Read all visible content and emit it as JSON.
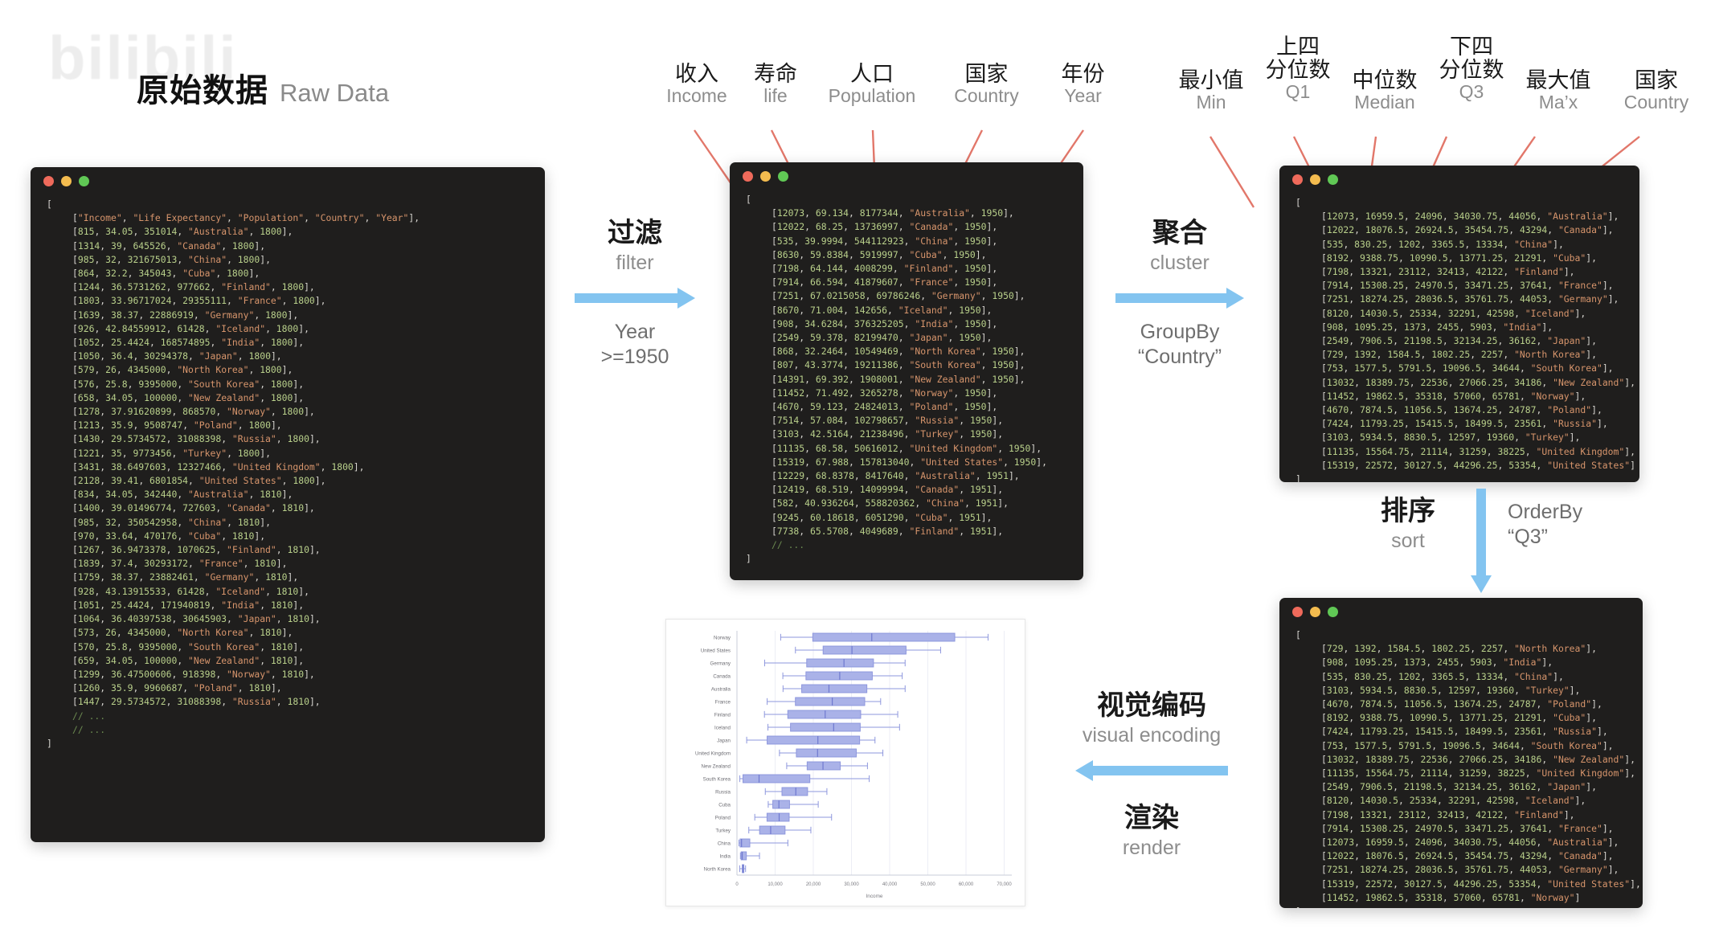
{
  "watermark": {
    "text": "bilibili"
  },
  "title": {
    "cn": "原始数据",
    "en": "Raw Data"
  },
  "raw_callouts": [
    {
      "cn": "收入",
      "en": "Income"
    },
    {
      "cn": "寿命",
      "en": "life"
    },
    {
      "cn": "人口",
      "en": "Population"
    },
    {
      "cn": "国家",
      "en": "Country"
    },
    {
      "cn": "年份",
      "en": "Year"
    }
  ],
  "agg_callouts": [
    {
      "sup": "",
      "cn": "最小值",
      "en": "Min"
    },
    {
      "sup": "上四",
      "cn": "分位数",
      "en": "Q1"
    },
    {
      "sup": "",
      "cn": "中位数",
      "en": "Median"
    },
    {
      "sup": "下四",
      "cn": "分位数",
      "en": "Q3"
    },
    {
      "sup": "",
      "cn": "最大值",
      "en": "Ma’x"
    },
    {
      "sup": "",
      "cn": "国家",
      "en": "Country"
    }
  ],
  "steps": {
    "filter": {
      "cn": "过滤",
      "en": "filter",
      "sub": "Year\n>=1950"
    },
    "cluster": {
      "cn": "聚合",
      "en": "cluster",
      "sub": "GroupBy\n“Country”"
    },
    "sort": {
      "cn": "排序",
      "en": "sort",
      "sub": "OrderBy\n“Q3”"
    },
    "encode": {
      "cn": "视觉编码",
      "en": "visual encoding"
    },
    "render": {
      "cn": "渲染",
      "en": "render"
    }
  },
  "terminals": {
    "raw": {
      "header": [
        "Income",
        "Life Expectancy",
        "Population",
        "Country",
        "Year"
      ],
      "rows": [
        [
          815,
          34.05,
          351014,
          "Australia",
          1800
        ],
        [
          1314,
          39,
          645526,
          "Canada",
          1800
        ],
        [
          985,
          32,
          321675013,
          "China",
          1800
        ],
        [
          864,
          32.2,
          345043,
          "Cuba",
          1800
        ],
        [
          1244,
          36.5731262,
          977662,
          "Finland",
          1800
        ],
        [
          1803,
          33.96717024,
          29355111,
          "France",
          1800
        ],
        [
          1639,
          38.37,
          22886919,
          "Germany",
          1800
        ],
        [
          926,
          42.84559912,
          61428,
          "Iceland",
          1800
        ],
        [
          1052,
          25.4424,
          168574895,
          "India",
          1800
        ],
        [
          1050,
          36.4,
          30294378,
          "Japan",
          1800
        ],
        [
          579,
          26,
          4345000,
          "North Korea",
          1800
        ],
        [
          576,
          25.8,
          9395000,
          "South Korea",
          1800
        ],
        [
          658,
          34.05,
          100000,
          "New Zealand",
          1800
        ],
        [
          1278,
          37.91620899,
          868570,
          "Norway",
          1800
        ],
        [
          1213,
          35.9,
          9508747,
          "Poland",
          1800
        ],
        [
          1430,
          29.5734572,
          31088398,
          "Russia",
          1800
        ],
        [
          1221,
          35,
          9773456,
          "Turkey",
          1800
        ],
        [
          3431,
          38.6497603,
          12327466,
          "United Kingdom",
          1800
        ],
        [
          2128,
          39.41,
          6801854,
          "United States",
          1800
        ],
        [
          834,
          34.05,
          342440,
          "Australia",
          1810
        ],
        [
          1400,
          39.01496774,
          727603,
          "Canada",
          1810
        ],
        [
          985,
          32,
          350542958,
          "China",
          1810
        ],
        [
          970,
          33.64,
          470176,
          "Cuba",
          1810
        ],
        [
          1267,
          36.9473378,
          1070625,
          "Finland",
          1810
        ],
        [
          1839,
          37.4,
          30293172,
          "France",
          1810
        ],
        [
          1759,
          38.37,
          23882461,
          "Germany",
          1810
        ],
        [
          928,
          43.13915533,
          61428,
          "Iceland",
          1810
        ],
        [
          1051,
          25.4424,
          171940819,
          "India",
          1810
        ],
        [
          1064,
          36.40397538,
          30645903,
          "Japan",
          1810
        ],
        [
          573,
          26,
          4345000,
          "North Korea",
          1810
        ],
        [
          570,
          25.8,
          9395000,
          "South Korea",
          1810
        ],
        [
          659,
          34.05,
          100000,
          "New Zealand",
          1810
        ],
        [
          1299,
          36.47500606,
          918398,
          "Norway",
          1810
        ],
        [
          1260,
          35.9,
          9960687,
          "Poland",
          1810
        ],
        [
          1447,
          29.5734572,
          31088398,
          "Russia",
          1810
        ]
      ],
      "ellipses": 2
    },
    "filtered": {
      "rows": [
        [
          12073,
          69.134,
          8177344,
          "Australia",
          1950
        ],
        [
          12022,
          68.25,
          13736997,
          "Canada",
          1950
        ],
        [
          535,
          39.9994,
          544112923,
          "China",
          1950
        ],
        [
          8630,
          59.8384,
          5919997,
          "Cuba",
          1950
        ],
        [
          7198,
          64.144,
          4008299,
          "Finland",
          1950
        ],
        [
          7914,
          66.594,
          41879607,
          "France",
          1950
        ],
        [
          7251,
          67.0215058,
          69786246,
          "Germany",
          1950
        ],
        [
          8670,
          71.004,
          142656,
          "Iceland",
          1950
        ],
        [
          908,
          34.6284,
          376325205,
          "India",
          1950
        ],
        [
          2549,
          59.378,
          82199470,
          "Japan",
          1950
        ],
        [
          868,
          32.2464,
          10549469,
          "North Korea",
          1950
        ],
        [
          807,
          43.3774,
          19211386,
          "South Korea",
          1950
        ],
        [
          14391,
          69.392,
          1908001,
          "New Zealand",
          1950
        ],
        [
          11452,
          71.492,
          3265278,
          "Norway",
          1950
        ],
        [
          4670,
          59.123,
          24824013,
          "Poland",
          1950
        ],
        [
          7514,
          57.084,
          102798657,
          "Russia",
          1950
        ],
        [
          3103,
          42.5164,
          21238496,
          "Turkey",
          1950
        ],
        [
          11135,
          68.58,
          50616012,
          "United Kingdom",
          1950
        ],
        [
          15319,
          67.988,
          157813040,
          "United States",
          1950
        ],
        [
          12229,
          68.8378,
          8417640,
          "Australia",
          1951
        ],
        [
          12419,
          68.519,
          14099994,
          "Canada",
          1951
        ],
        [
          582,
          40.936264,
          558820362,
          "China",
          1951
        ],
        [
          9245,
          60.18618,
          6051290,
          "Cuba",
          1951
        ],
        [
          7738,
          65.5708,
          4049689,
          "Finland",
          1951
        ]
      ],
      "ellipses": 1
    },
    "aggregated": {
      "rows": [
        [
          12073,
          16959.5,
          24096,
          34030.75,
          44056,
          "Australia"
        ],
        [
          12022,
          18076.5,
          26924.5,
          35454.75,
          43294,
          "Canada"
        ],
        [
          535,
          830.25,
          1202,
          3365.5,
          13334,
          "China"
        ],
        [
          8192,
          9388.75,
          10990.5,
          13771.25,
          21291,
          "Cuba"
        ],
        [
          7198,
          13321,
          23112,
          32413,
          42122,
          "Finland"
        ],
        [
          7914,
          15308.25,
          24970.5,
          33471.25,
          37641,
          "France"
        ],
        [
          7251,
          18274.25,
          28036.5,
          35761.75,
          44053,
          "Germany"
        ],
        [
          8120,
          14030.5,
          25334,
          32291,
          42598,
          "Iceland"
        ],
        [
          908,
          1095.25,
          1373,
          2455,
          5903,
          "India"
        ],
        [
          2549,
          7906.5,
          21198.5,
          32134.25,
          36162,
          "Japan"
        ],
        [
          729,
          1392,
          1584.5,
          1802.25,
          2257,
          "North Korea"
        ],
        [
          753,
          1577.5,
          5791.5,
          19096.5,
          34644,
          "South Korea"
        ],
        [
          13032,
          18389.75,
          22536,
          27066.25,
          34186,
          "New Zealand"
        ],
        [
          11452,
          19862.5,
          35318,
          57060,
          65781,
          "Norway"
        ],
        [
          4670,
          7874.5,
          11056.5,
          13674.25,
          24787,
          "Poland"
        ],
        [
          7424,
          11793.25,
          15415.5,
          18499.5,
          23561,
          "Russia"
        ],
        [
          3103,
          5934.5,
          8830.5,
          12597,
          19360,
          "Turkey"
        ],
        [
          11135,
          15564.75,
          21114,
          31259,
          38225,
          "United Kingdom"
        ],
        [
          15319,
          22572,
          30127.5,
          44296.25,
          53354,
          "United States"
        ]
      ],
      "ellipses": 0
    },
    "sorted": {
      "rows": [
        [
          729,
          1392,
          1584.5,
          1802.25,
          2257,
          "North Korea"
        ],
        [
          908,
          1095.25,
          1373,
          2455,
          5903,
          "India"
        ],
        [
          535,
          830.25,
          1202,
          3365.5,
          13334,
          "China"
        ],
        [
          3103,
          5934.5,
          8830.5,
          12597,
          19360,
          "Turkey"
        ],
        [
          4670,
          7874.5,
          11056.5,
          13674.25,
          24787,
          "Poland"
        ],
        [
          8192,
          9388.75,
          10990.5,
          13771.25,
          21291,
          "Cuba"
        ],
        [
          7424,
          11793.25,
          15415.5,
          18499.5,
          23561,
          "Russia"
        ],
        [
          753,
          1577.5,
          5791.5,
          19096.5,
          34644,
          "South Korea"
        ],
        [
          13032,
          18389.75,
          22536,
          27066.25,
          34186,
          "New Zealand"
        ],
        [
          11135,
          15564.75,
          21114,
          31259,
          38225,
          "United Kingdom"
        ],
        [
          2549,
          7906.5,
          21198.5,
          32134.25,
          36162,
          "Japan"
        ],
        [
          8120,
          14030.5,
          25334,
          32291,
          42598,
          "Iceland"
        ],
        [
          7198,
          13321,
          23112,
          32413,
          42122,
          "Finland"
        ],
        [
          7914,
          15308.25,
          24970.5,
          33471.25,
          37641,
          "France"
        ],
        [
          12073,
          16959.5,
          24096,
          34030.75,
          44056,
          "Australia"
        ],
        [
          12022,
          18076.5,
          26924.5,
          35454.75,
          43294,
          "Canada"
        ],
        [
          7251,
          18274.25,
          28036.5,
          35761.75,
          44053,
          "Germany"
        ],
        [
          15319,
          22572,
          30127.5,
          44296.25,
          53354,
          "United States"
        ],
        [
          11452,
          19862.5,
          35318,
          57060,
          65781,
          "Norway"
        ]
      ],
      "ellipses": 0
    }
  },
  "chart_data": {
    "type": "boxplot",
    "title": "",
    "xlabel": "Income",
    "ylabel": "",
    "xlim": [
      0,
      72000
    ],
    "xticks": [
      0,
      10000,
      20000,
      30000,
      40000,
      50000,
      60000,
      70000
    ],
    "xtick_labels": [
      "0",
      "10,000",
      "20,000",
      "30,000",
      "40,000",
      "50,000",
      "60,000",
      "70,000"
    ],
    "grid": true,
    "box_fill": "#aab2e8",
    "box_stroke": "#8e97dd",
    "categories": [
      "Norway",
      "United States",
      "Germany",
      "Canada",
      "Australia",
      "France",
      "Finland",
      "Iceland",
      "Japan",
      "United Kingdom",
      "New Zealand",
      "South Korea",
      "Russia",
      "Cuba",
      "Poland",
      "Turkey",
      "China",
      "India",
      "North Korea"
    ],
    "boxes": [
      {
        "country": "Norway",
        "min": 11452,
        "q1": 19862.5,
        "median": 35318,
        "q3": 57060,
        "max": 65781
      },
      {
        "country": "United States",
        "min": 15319,
        "q1": 22572,
        "median": 30127.5,
        "q3": 44296.25,
        "max": 53354
      },
      {
        "country": "Germany",
        "min": 7251,
        "q1": 18274.25,
        "median": 28036.5,
        "q3": 35761.75,
        "max": 44053
      },
      {
        "country": "Canada",
        "min": 12022,
        "q1": 18076.5,
        "median": 26924.5,
        "q3": 35454.75,
        "max": 43294
      },
      {
        "country": "Australia",
        "min": 12073,
        "q1": 16959.5,
        "median": 24096,
        "q3": 34030.75,
        "max": 44056
      },
      {
        "country": "France",
        "min": 7914,
        "q1": 15308.25,
        "median": 24970.5,
        "q3": 33471.25,
        "max": 37641
      },
      {
        "country": "Finland",
        "min": 7198,
        "q1": 13321,
        "median": 23112,
        "q3": 32413,
        "max": 42122
      },
      {
        "country": "Iceland",
        "min": 8120,
        "q1": 14030.5,
        "median": 25334,
        "q3": 32291,
        "max": 42598
      },
      {
        "country": "Japan",
        "min": 2549,
        "q1": 7906.5,
        "median": 21198.5,
        "q3": 32134.25,
        "max": 36162
      },
      {
        "country": "United Kingdom",
        "min": 11135,
        "q1": 15564.75,
        "median": 21114,
        "q3": 31259,
        "max": 38225
      },
      {
        "country": "New Zealand",
        "min": 13032,
        "q1": 18389.75,
        "median": 22536,
        "q3": 27066.25,
        "max": 34186
      },
      {
        "country": "South Korea",
        "min": 753,
        "q1": 1577.5,
        "median": 5791.5,
        "q3": 19096.5,
        "max": 34644
      },
      {
        "country": "Russia",
        "min": 7424,
        "q1": 11793.25,
        "median": 15415.5,
        "q3": 18499.5,
        "max": 23561
      },
      {
        "country": "Cuba",
        "min": 8192,
        "q1": 9388.75,
        "median": 10990.5,
        "q3": 13771.25,
        "max": 21291
      },
      {
        "country": "Poland",
        "min": 4670,
        "q1": 7874.5,
        "median": 11056.5,
        "q3": 13674.25,
        "max": 24787
      },
      {
        "country": "Turkey",
        "min": 3103,
        "q1": 5934.5,
        "median": 8830.5,
        "q3": 12597,
        "max": 19360
      },
      {
        "country": "China",
        "min": 535,
        "q1": 830.25,
        "median": 1202,
        "q3": 3365.5,
        "max": 13334
      },
      {
        "country": "India",
        "min": 908,
        "q1": 1095.25,
        "median": 1373,
        "q3": 2455,
        "max": 5903
      },
      {
        "country": "North Korea",
        "min": 729,
        "q1": 1392,
        "median": 1584.5,
        "q3": 1802.25,
        "max": 2257
      }
    ]
  }
}
